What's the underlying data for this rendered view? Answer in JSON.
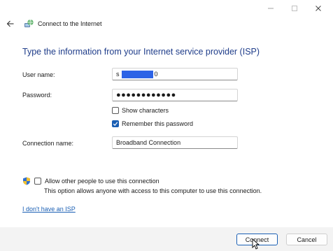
{
  "window": {
    "title": "Connect to the Internet"
  },
  "heading": "Type the information from your Internet service provider (ISP)",
  "form": {
    "username_label": "User name:",
    "username_prefix": "s",
    "username_suffix": "0",
    "password_label": "Password:",
    "password_value": "●●●●●●●●●●●●",
    "show_characters_label": "Show characters",
    "show_characters_checked": false,
    "remember_password_label": "Remember this password",
    "remember_password_checked": true,
    "connection_name_label": "Connection name:",
    "connection_name_value": "Broadband Connection"
  },
  "sharing": {
    "allow_label": "Allow other people to use this connection",
    "allow_checked": false,
    "description": "This option allows anyone with access to this computer to use this connection."
  },
  "link": {
    "no_isp": "I don't have an ISP"
  },
  "buttons": {
    "connect": "Connect",
    "cancel": "Cancel"
  },
  "colors": {
    "heading": "#1f3d8a",
    "accent": "#1a5fb4",
    "redaction": "#2d63e6"
  },
  "icons": {
    "back": "back-arrow-icon",
    "network": "network-globe-icon",
    "shield": "uac-shield-icon"
  }
}
